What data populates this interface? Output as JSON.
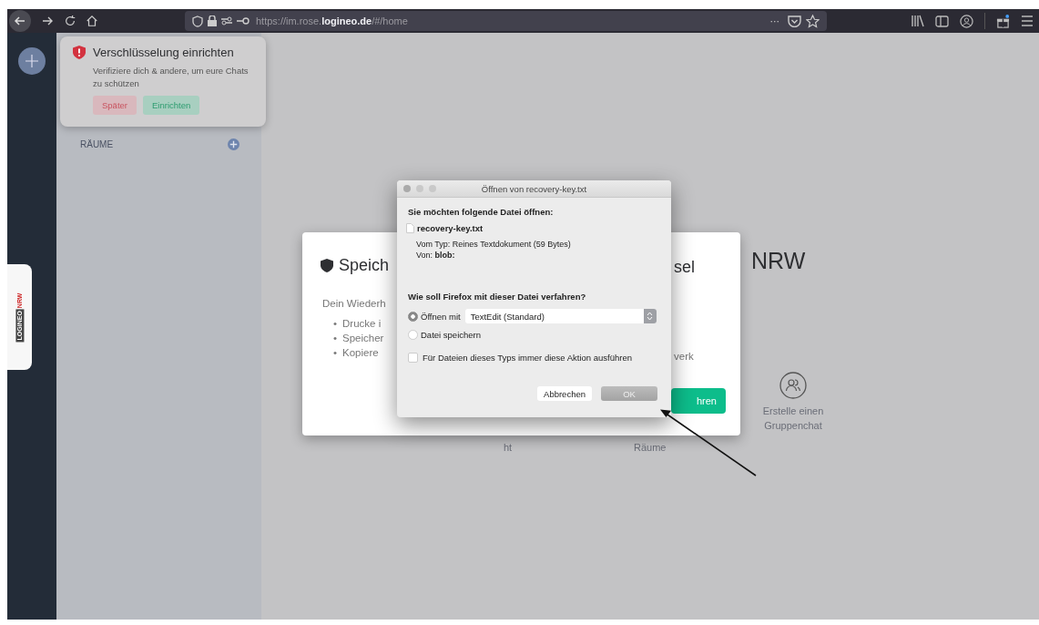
{
  "browser": {
    "url": "https://im.rose.**logineo.de**/#/home",
    "menu_dots": "···"
  },
  "sidebar": {
    "section_title": "RÄUME"
  },
  "side_tab": {
    "brand": "LOGINEO",
    "brand_accent": "NRW"
  },
  "toast": {
    "title": "Verschlüsselung einrichten",
    "message": "Verifiziere dich & andere, um eure Chats zu schützen",
    "buttons": [
      {
        "label": "Später",
        "kind": "danger"
      },
      {
        "label": "Einrichten",
        "kind": "primary"
      }
    ]
  },
  "home": {
    "heading": "NRW",
    "actions": [
      {
        "label": "ht",
        "kind": "text"
      },
      {
        "label": "Räume",
        "kind": "text"
      },
      {
        "label": "Erstelle einen Gruppenchat",
        "kind": "icon"
      }
    ]
  },
  "modal": {
    "title": "Speich",
    "title_end": "sel",
    "intro": "Dein Wiederh",
    "bullets": [
      {
        "marker": "•",
        "text": "Drucke i"
      },
      {
        "marker": "•",
        "text": "Speicher"
      },
      {
        "marker": "•",
        "text": "Kopiere"
      }
    ],
    "side_text": "verk",
    "button": "hren"
  },
  "dialog": {
    "title": "Öffnen von recovery-key.txt",
    "question": "Sie möchten folgende Datei öffnen:",
    "file_name": "recovery-key.txt",
    "type_line": "Vom Typ: Reines Textdokument (59 Bytes)",
    "from_line": "Von: **blob:**",
    "action_question": "Wie soll Firefox mit dieser Datei verfahren?",
    "options": [
      {
        "label": "Öffnen mit",
        "selected": true,
        "app": "TextEdit (Standard)"
      },
      {
        "label": "Datei speichern",
        "selected": false
      }
    ],
    "remember": {
      "label": "Für Dateien dieses Typs immer diese Aktion ausführen",
      "checked": false
    },
    "buttons": [
      {
        "label": "Abbrechen",
        "kind": "secondary"
      },
      {
        "label": "OK",
        "kind": "default"
      }
    ]
  }
}
